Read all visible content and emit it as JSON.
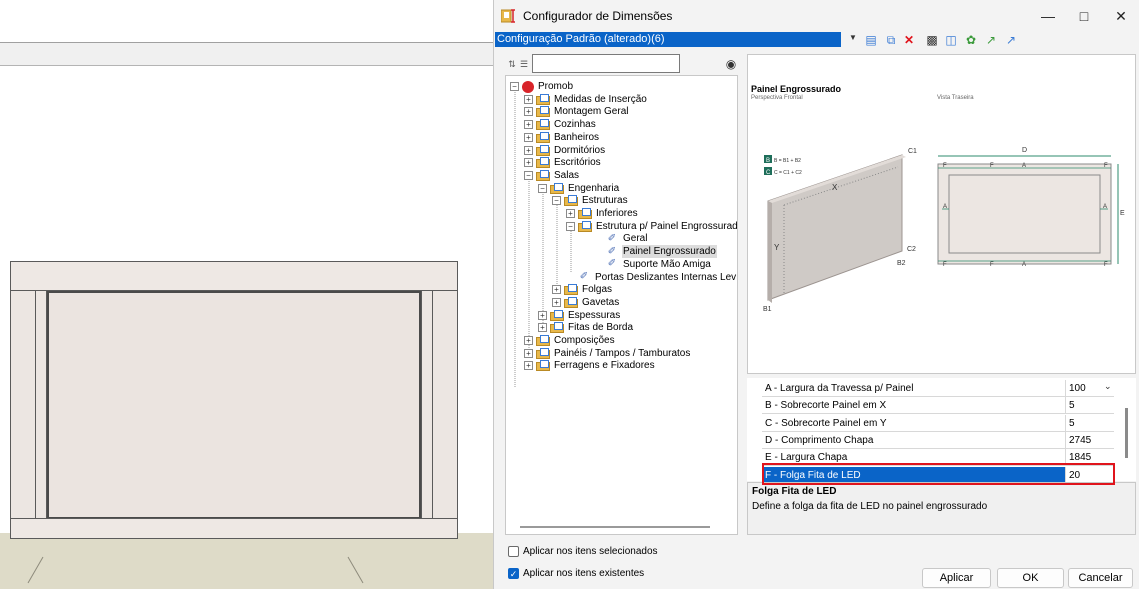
{
  "dialog": {
    "title": "Configurador de Dimensões",
    "config_selected": "Configuração Padrão (alterado)(6)"
  },
  "tree": {
    "items": [
      {
        "label": "Promob",
        "kind": "root"
      },
      {
        "label": "Medidas de Inserção",
        "kind": "folder"
      },
      {
        "label": "Montagem Geral",
        "kind": "folder"
      },
      {
        "label": "Cozinhas",
        "kind": "folder"
      },
      {
        "label": "Banheiros",
        "kind": "folder"
      },
      {
        "label": "Dormitórios",
        "kind": "folder"
      },
      {
        "label": "Escritórios",
        "kind": "folder"
      },
      {
        "label": "Salas",
        "kind": "folder"
      },
      {
        "label": "Engenharia",
        "kind": "folder"
      },
      {
        "label": "Estruturas",
        "kind": "folder"
      },
      {
        "label": "Inferiores",
        "kind": "folder"
      },
      {
        "label": "Estrutura p/ Painel Engrossurad",
        "kind": "folder"
      },
      {
        "label": "Geral",
        "kind": "leaf"
      },
      {
        "label": "Painel Engrossurado",
        "kind": "leaf"
      },
      {
        "label": "Suporte Mão Amiga",
        "kind": "leaf"
      },
      {
        "label": "Portas Deslizantes Internas Lev",
        "kind": "leaf"
      },
      {
        "label": "Folgas",
        "kind": "folder"
      },
      {
        "label": "Gavetas",
        "kind": "folder"
      },
      {
        "label": "Espessuras",
        "kind": "folder"
      },
      {
        "label": "Fitas de Borda",
        "kind": "folder"
      },
      {
        "label": "Composições",
        "kind": "folder"
      },
      {
        "label": "Painéis / Tampos / Tamburatos",
        "kind": "folder"
      },
      {
        "label": "Ferragens e Fixadores",
        "kind": "folder"
      }
    ]
  },
  "preview": {
    "title": "Painel Engrossurado",
    "subtitle_front": "Perspectiva Frontal",
    "subtitle_back": "Vista Traseira",
    "legend_b": "B = B1 + B2",
    "legend_c": "C = C1 + C2",
    "labels": {
      "X": "X",
      "Y": "Y",
      "C1": "C1",
      "C2": "C2",
      "B1": "B1",
      "B2": "B2",
      "D": "D",
      "E": "E",
      "A": "A",
      "F": "F",
      "B": "B",
      "C": "C"
    }
  },
  "properties": [
    {
      "name": "A - Largura da Travessa p/ Painel",
      "value": "100"
    },
    {
      "name": "B - Sobrecorte Painel em X",
      "value": "5"
    },
    {
      "name": "C - Sobrecorte Painel em Y",
      "value": "5"
    },
    {
      "name": "D - Comprimento Chapa",
      "value": "2745"
    },
    {
      "name": "E - Largura Chapa",
      "value": "1845"
    },
    {
      "name": "F - Folga Fita de LED",
      "value": "20"
    }
  ],
  "description": {
    "title": "Folga Fita de LED",
    "text": "Define a folga da fita de LED no painel engrossurado"
  },
  "options": {
    "apply_selected": "Aplicar nos itens selecionados",
    "apply_existing": "Aplicar nos itens existentes"
  },
  "buttons": {
    "apply": "Aplicar",
    "ok": "OK",
    "cancel": "Cancelar"
  },
  "colors": {
    "accent": "#0a64c8",
    "highlight": "#e0141c"
  }
}
